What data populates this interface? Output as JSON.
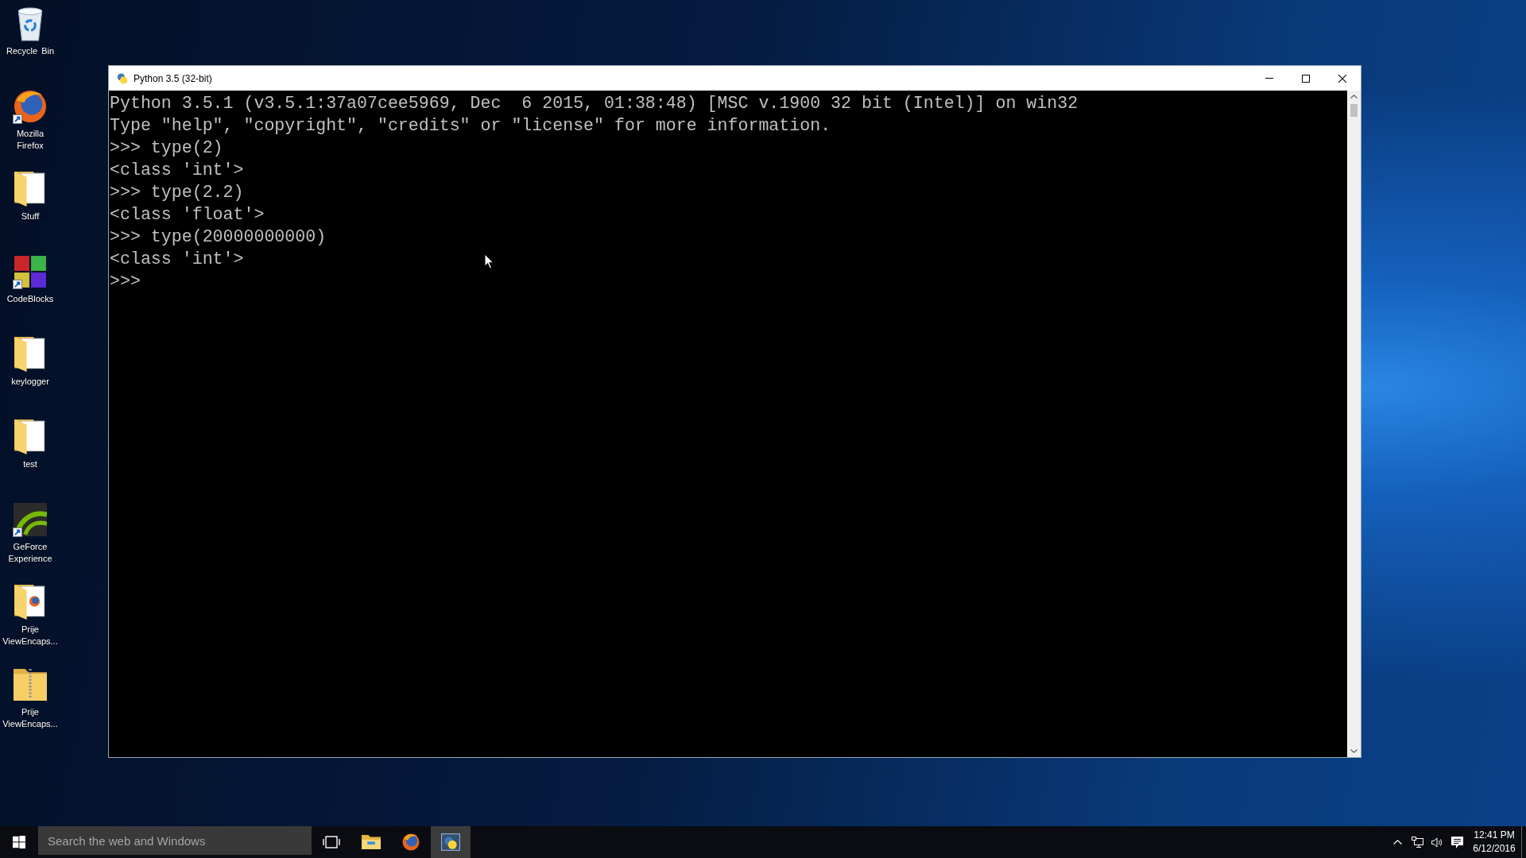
{
  "desktop_icons": [
    {
      "label": "Recycle Bin",
      "kind": "recycle-bin",
      "shortcut": false
    },
    {
      "label": "Mozilla Firefox",
      "kind": "firefox",
      "shortcut": true
    },
    {
      "label": "Stuff",
      "kind": "folder",
      "shortcut": false
    },
    {
      "label": "CodeBlocks",
      "kind": "codeblocks",
      "shortcut": true
    },
    {
      "label": "keylogger",
      "kind": "folder",
      "shortcut": false
    },
    {
      "label": "test",
      "kind": "folder",
      "shortcut": false
    },
    {
      "label": "GeForce Experience",
      "kind": "nvidia",
      "shortcut": true
    },
    {
      "label": "Prije ViewEncaps...",
      "kind": "folder-firefox",
      "shortcut": false
    },
    {
      "label": "Prije ViewEncaps...",
      "kind": "zip-folder",
      "shortcut": false
    }
  ],
  "console_window": {
    "title": "Python 3.5 (32-bit)",
    "lines": [
      "Python 3.5.1 (v3.5.1:37a07cee5969, Dec  6 2015, 01:38:48) [MSC v.1900 32 bit (Intel)] on win32",
      "Type \"help\", \"copyright\", \"credits\" or \"license\" for more information.",
      ">>> type(2)",
      "<class 'int'>",
      ">>> type(2.2)",
      "<class 'float'>",
      ">>> type(20000000000)",
      "<class 'int'>",
      ">>>"
    ]
  },
  "taskbar": {
    "search": {
      "placeholder": "Search the web and Windows"
    },
    "apps": [
      {
        "kind": "file-explorer",
        "active": false
      },
      {
        "kind": "firefox",
        "active": false
      },
      {
        "kind": "python-console",
        "active": true
      }
    ],
    "clock": {
      "time": "12:41 PM",
      "date": "6/12/2016"
    }
  }
}
